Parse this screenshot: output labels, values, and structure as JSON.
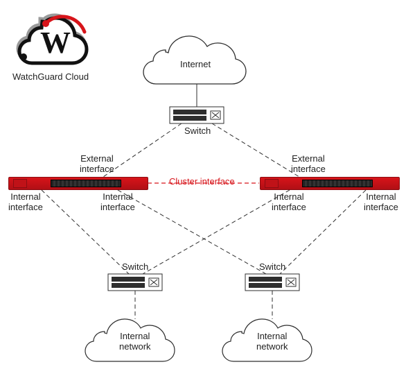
{
  "logo_caption": "WatchGuard Cloud",
  "nodes": {
    "internet": "Internet",
    "switch_top": "Switch",
    "switch_bl": "Switch",
    "switch_br": "Switch",
    "net_bl": "Internal\nnetwork",
    "net_br": "Internal\nnetwork"
  },
  "interface_labels": {
    "ext_left": "External\ninterface",
    "ext_right": "External\ninterface",
    "int_ll": "Internal\ninterface",
    "int_lr": "Internal\ninterface",
    "int_rl": "Internal\ninterface",
    "int_rr": "Internal\ninterface",
    "cluster": "Cluster interface"
  },
  "colors": {
    "accent": "#d7141a",
    "stroke": "#2e2e2e"
  }
}
